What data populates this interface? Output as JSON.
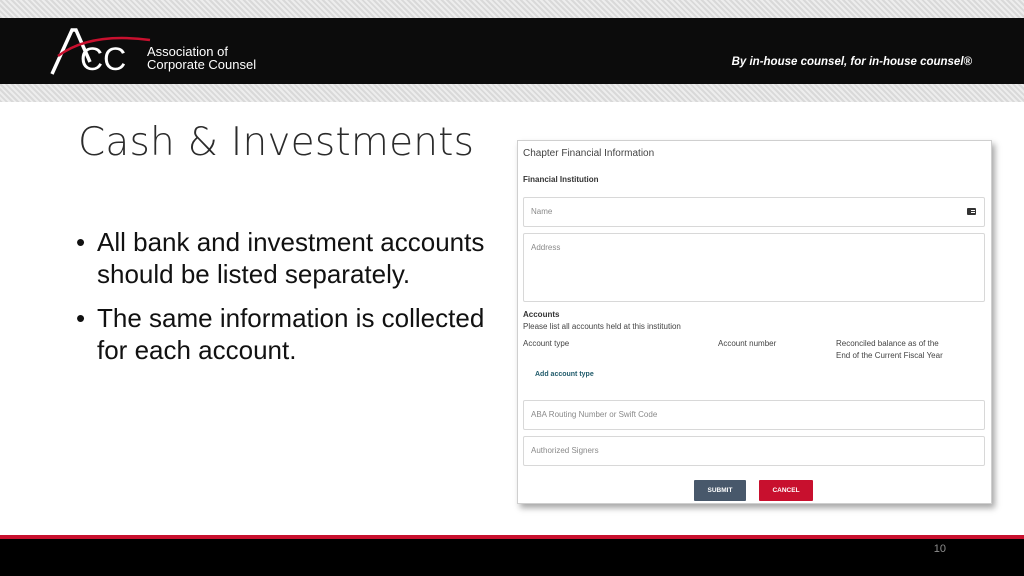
{
  "header": {
    "logo_sub_line1": "Association of",
    "logo_sub_line2": "Corporate Counsel",
    "tagline": "By in-house counsel, for in-house counsel®",
    "colors": {
      "band": "#0c0c0c",
      "accent": "#c8102e"
    }
  },
  "slide": {
    "title": "Cash & Investments",
    "bullets": [
      "All bank and investment accounts should be listed separately.",
      "The same information is collected for each account."
    ]
  },
  "form": {
    "title": "Chapter Financial Information",
    "section_label": "Financial Institution",
    "name_placeholder": "Name",
    "name_icon": "id-card-icon",
    "address_placeholder": "Address",
    "accounts_heading": "Accounts",
    "accounts_description": "Please list all accounts held at this institution",
    "columns": {
      "account_type": "Account type",
      "account_number": "Account number",
      "balance_line1": "Reconciled balance as of the",
      "balance_line2": "End of the Current Fiscal Year"
    },
    "add_account_link": "Add account type",
    "aba_placeholder": "ABA Routing Number or Swift Code",
    "signers_placeholder": "Authorized Signers",
    "submit_label": "SUBMIT",
    "cancel_label": "CANCEL"
  },
  "footer": {
    "page_number": "10"
  }
}
